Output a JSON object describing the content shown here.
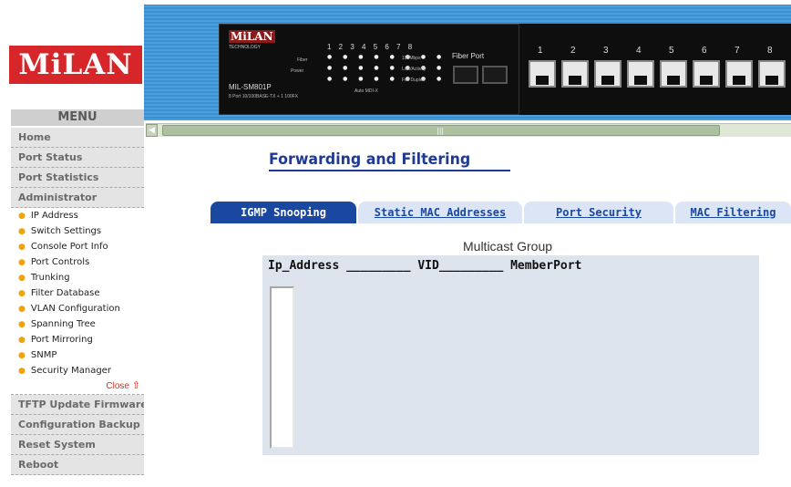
{
  "brand": {
    "logo": "MiLAN"
  },
  "menu": {
    "header": "MENU",
    "main_items_top": [
      "Home",
      "Port Status",
      "Port Statistics",
      "Administrator"
    ],
    "sub_items": [
      "IP Address",
      "Switch Settings",
      "Console Port Info",
      "Port Controls",
      "Trunking",
      "Filter Database",
      "VLAN Configuration",
      "Spanning Tree",
      "Port Mirroring",
      "SNMP",
      "Security Manager"
    ],
    "close_label": "Close",
    "main_items_bottom": [
      "TFTP Update Firmware",
      "Configuration Backup",
      "Reset System",
      "Reboot"
    ]
  },
  "device": {
    "brand": "MiLAN",
    "brand_sub": "TECHNOLOGY",
    "model": "MIL-SM801P",
    "description": "8 Port 10/100BASE-TX + 1 100FX",
    "led_numbers": "1 2 3 4 5 6 7 8",
    "led_labels": [
      "100Mbps",
      "Link/Activity",
      "Full Duplex"
    ],
    "power_label": "Power",
    "fiber_label": "Fiber",
    "auto_mdix_label": "Auto MDI-X",
    "fiber_port_label": "Fiber Port",
    "port_numbers": [
      "1",
      "2",
      "3",
      "4",
      "5",
      "6",
      "7",
      "8"
    ]
  },
  "page": {
    "title": "Forwarding and Filtering"
  },
  "tabs": [
    {
      "label": "IGMP Snooping",
      "active": true
    },
    {
      "label": "Static MAC Addresses",
      "active": false
    },
    {
      "label": "Port Security",
      "active": false
    },
    {
      "label": "MAC Filtering",
      "active": false
    }
  ],
  "multicast": {
    "caption": "Multicast Group",
    "header": "Ip_Address _________ VID_________ MemberPort"
  },
  "colors": {
    "logo_red": "#d7262a",
    "tab_active": "#1a47a0",
    "title_blue": "#1f3a93",
    "panel_bg": "#dde4ee",
    "banner_blue": "#4aa0dc"
  }
}
